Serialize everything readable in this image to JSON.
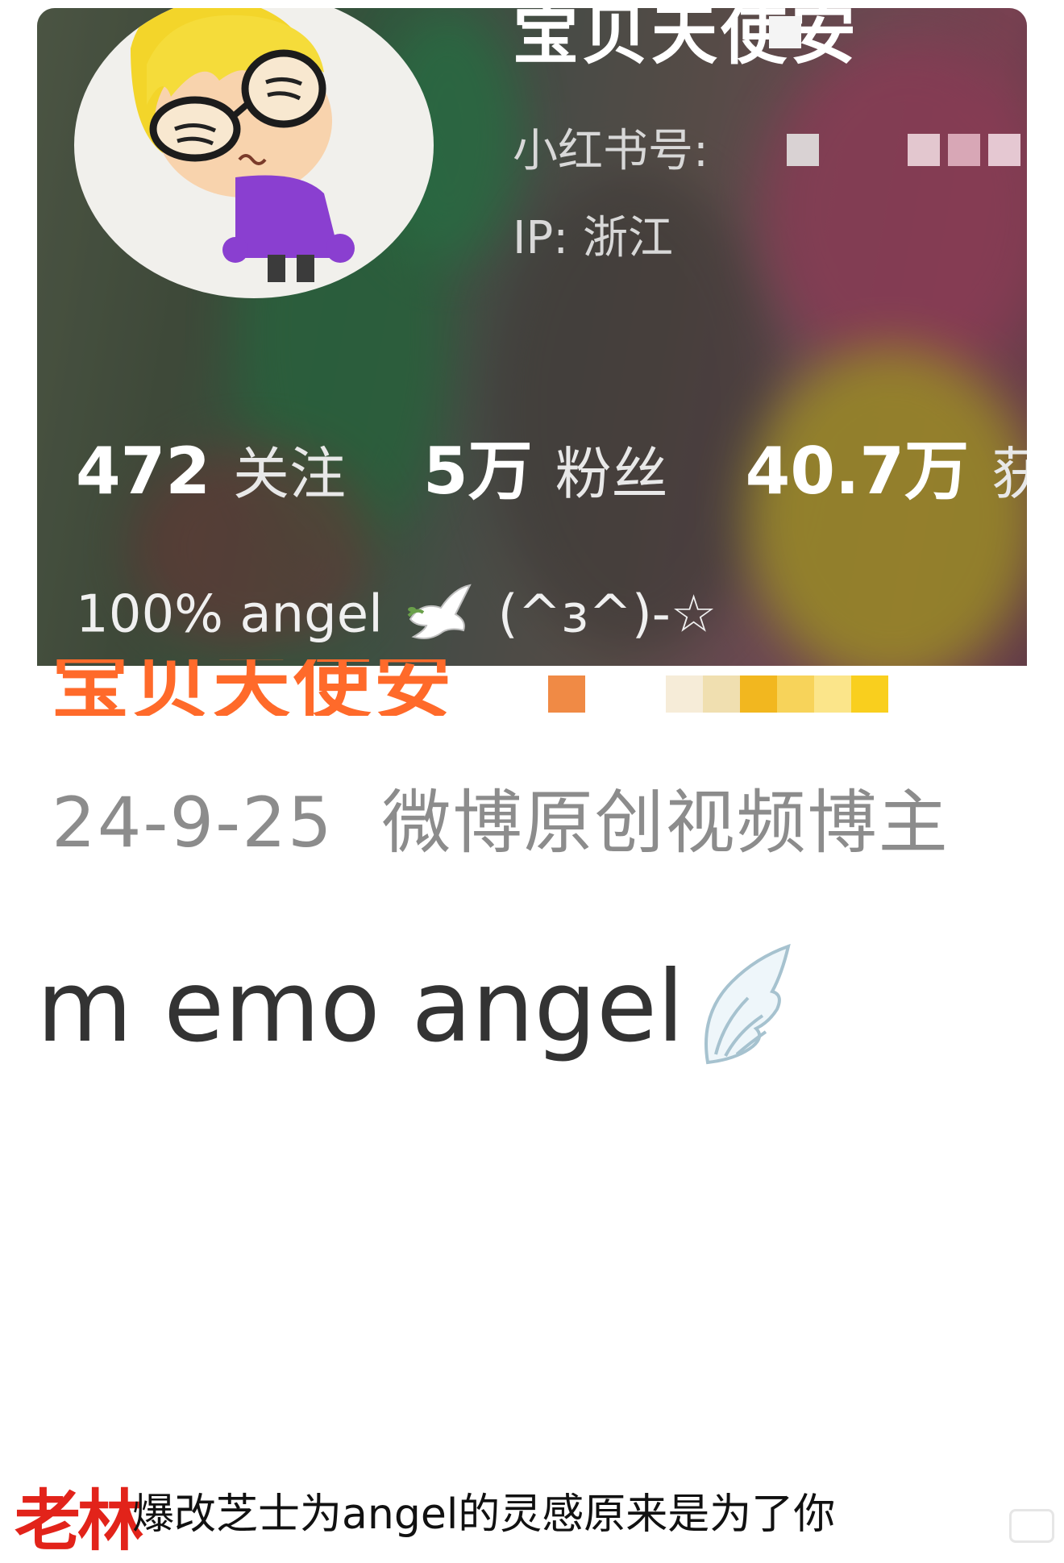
{
  "profile_card": {
    "name": "宝贝天使安",
    "xhs_id_label": "小红书号:",
    "ip_label": "IP: 浙江",
    "stats": [
      {
        "value": "472",
        "label": "关注"
      },
      {
        "value": "5万",
        "label": "粉丝"
      },
      {
        "value": "40.7万",
        "label": "获"
      }
    ],
    "bio_text": "100% angel",
    "bio_emoji": "dove-emoji",
    "bio_emote": "(^ɜ^)-☆"
  },
  "weibo": {
    "name": "宝贝天使安",
    "date": "24-9-25",
    "verification": "微博原创视频博主",
    "description": "I'm emo angel",
    "description_emoji": "wing-emoji"
  },
  "caption": {
    "watermark": "老林",
    "text": "爆改芝士为angel的灵感原来是为了你"
  },
  "colors": {
    "weibo_name": "#ff6a2a",
    "watermark": "#e2231a",
    "meta_gray": "#8c8c8c"
  }
}
